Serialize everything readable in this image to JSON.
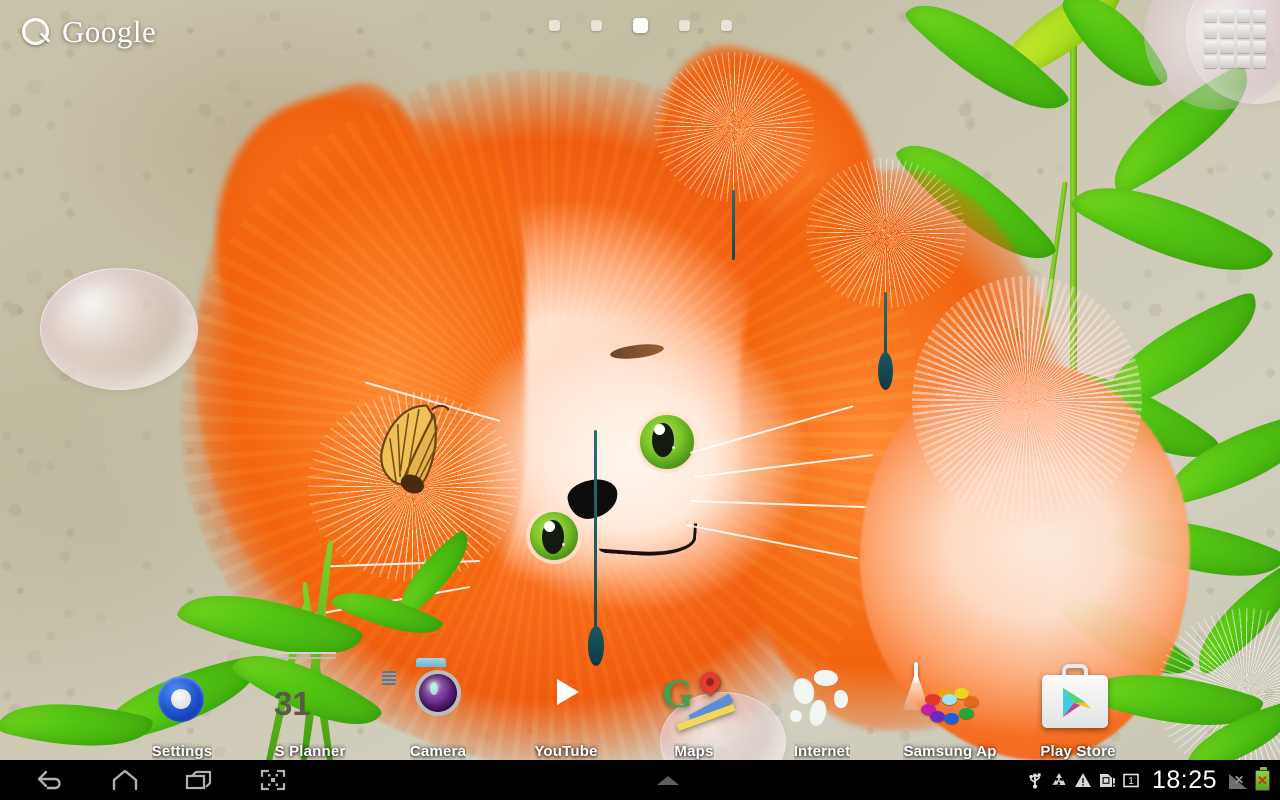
{
  "search_widget": {
    "label": "Google",
    "icon": "search-icon"
  },
  "page_indicator": {
    "total": 5,
    "active_index": 2
  },
  "apps_button": {
    "icon": "apps-grid-icon",
    "label": "Apps"
  },
  "dock": {
    "apps": [
      {
        "label": "Settings",
        "icon": "settings-gear-icon"
      },
      {
        "label": "S Planner",
        "icon": "calendar-icon",
        "day": "31"
      },
      {
        "label": "Camera",
        "icon": "camera-icon"
      },
      {
        "label": "YouTube",
        "icon": "youtube-icon"
      },
      {
        "label": "Maps",
        "icon": "maps-icon",
        "letter": "G"
      },
      {
        "label": "Internet",
        "icon": "globe-icon"
      },
      {
        "label": "Samsung Ap",
        "icon": "samsung-apps-icon"
      },
      {
        "label": "Play Store",
        "icon": "play-store-icon"
      }
    ]
  },
  "navbar": {
    "buttons": [
      {
        "name": "back",
        "icon": "back-arrow-icon"
      },
      {
        "name": "home",
        "icon": "home-icon"
      },
      {
        "name": "recents",
        "icon": "recent-apps-icon"
      },
      {
        "name": "screenshot",
        "icon": "screen-capture-icon"
      }
    ],
    "expand_icon": "chevron-up-icon",
    "status": {
      "icons": [
        {
          "name": "usb-icon",
          "glyph": "USB"
        },
        {
          "name": "sync-icon",
          "glyph": "recycle"
        },
        {
          "name": "warning-icon",
          "glyph": "!"
        },
        {
          "name": "sim-card-icon",
          "glyph": "SIM!"
        },
        {
          "name": "sd-card-icon",
          "glyph": "1"
        }
      ],
      "time": "18:25",
      "signal": {
        "name": "signal-no-service-icon",
        "glyph": "x"
      },
      "battery": {
        "name": "battery-error-icon",
        "glyph": "x",
        "color": "#6fc01e"
      }
    }
  },
  "wallpaper": {
    "description": "Fluffy orange fox among bamboo, dandelions and bubbles",
    "colors": {
      "background": "#c9c3ac",
      "fox": "#f96b1c",
      "leaf": "#54c613",
      "bubble": "#f0d8e2"
    }
  }
}
